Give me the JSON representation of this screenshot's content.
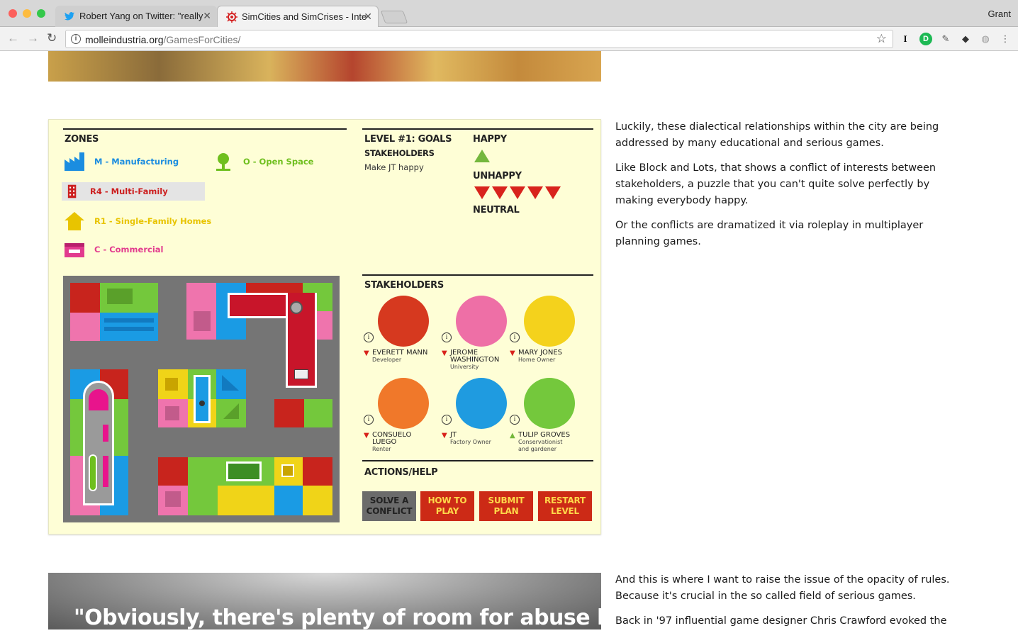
{
  "browser": {
    "tabs": [
      {
        "title": "Robert Yang on Twitter: \"really",
        "active": false
      },
      {
        "title": "SimCities and SimCrises - Inte",
        "active": true
      }
    ],
    "profile": "Grant",
    "url_host": "molleindustria.org",
    "url_path": "/GamesForCities/"
  },
  "game": {
    "zones_title": "ZONES",
    "zones": [
      {
        "label": "M - Manufacturing",
        "color": "#1b8de0",
        "icon": "factory-icon"
      },
      {
        "label": "O - Open Space",
        "color": "#6fbf1e",
        "icon": "tree-icon"
      },
      {
        "label": "R4 - Multi-Family",
        "color": "#cc1f1f",
        "icon": "apartment-icon",
        "selected": true
      },
      {
        "label": "R1 - Single-Family Homes",
        "color": "#e8c400",
        "icon": "house-icon"
      },
      {
        "label": "C - Commercial",
        "color": "#e23b8e",
        "icon": "shop-icon"
      }
    ],
    "goals": {
      "title": "LEVEL #1: GOALS",
      "stakeholders_label": "STAKEHOLDERS",
      "goal_text": "Make JT happy",
      "happy": "HAPPY",
      "unhappy": "UNHAPPY",
      "neutral": "NEUTRAL",
      "happy_count": 1,
      "unhappy_count": 5
    },
    "stakeholders_title": "STAKEHOLDERS",
    "stakeholders": [
      {
        "name": "EVERETT MANN",
        "role": "Developer",
        "mood": "unhappy",
        "color": "#d6391f"
      },
      {
        "name": "JEROME WASHINGTON",
        "role": "University",
        "mood": "unhappy",
        "color": "#ee6fa6"
      },
      {
        "name": "MARY JONES",
        "role": "Home Owner",
        "mood": "unhappy",
        "color": "#f4d21c"
      },
      {
        "name": "CONSUELO LUEGO",
        "role": "Renter",
        "mood": "unhappy",
        "color": "#f0782a"
      },
      {
        "name": "JT",
        "role": "Factory Owner",
        "mood": "unhappy",
        "color": "#1f9be0"
      },
      {
        "name": "TULIP GROVES",
        "role": "Conservationist and gardener",
        "mood": "happy",
        "color": "#74c83c"
      }
    ],
    "actions_title": "ACTIONS/HELP",
    "actions": [
      {
        "label": "SOLVE A CONFLICT",
        "style": "dark"
      },
      {
        "label": "HOW TO PLAY",
        "style": "red"
      },
      {
        "label": "SUBMIT PLAN",
        "style": "red"
      },
      {
        "label": "RESTART LEVEL",
        "style": "red"
      }
    ]
  },
  "article": {
    "p1": "Luckily, these dialectical relationships within the city are being addressed by many educational and serious games.",
    "p2": "Like Block and Lots, that shows a conflict of interests between stakeholders, a puzzle that you can't quite solve perfectly by making everybody happy.",
    "p3": "Or the conflicts are dramatized it via roleplay in multiplayer planning games.",
    "p4": "And this is where I want to raise the issue of the opacity of rules. Because it's crucial in the so called field of serious games.",
    "p5": "Back in '97 influential game designer Chris Crawford evoked the"
  },
  "quote_image_text": "\"Obviously, there's plenty of room for abuse here"
}
